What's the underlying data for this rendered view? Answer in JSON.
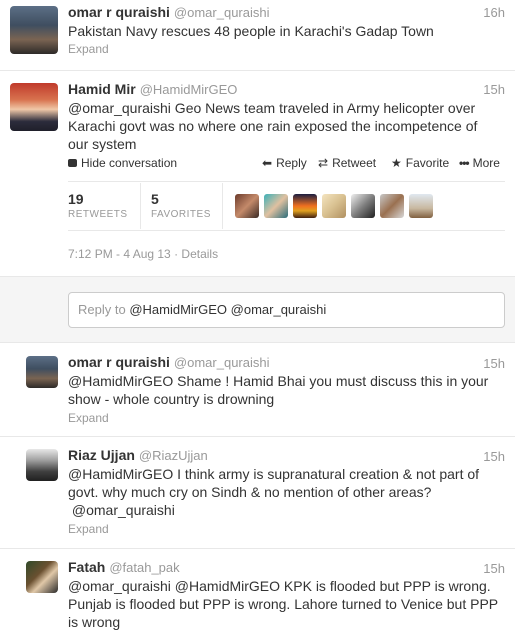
{
  "tweet1": {
    "name": "omar r quraishi",
    "handle": "@omar_quraishi",
    "time": "16h",
    "text": "Pakistan Navy rescues 48 people in Karachi's Gadap Town",
    "expand": "Expand"
  },
  "tweet2": {
    "name": "Hamid Mir",
    "handle": "@HamidMirGEO",
    "time": "15h",
    "line1": "@omar_quraishi Geo News team traveled in Army helicopter over",
    "line2": "Karachi govt was no where one rain exposed the incompetence of",
    "line3": "our system",
    "hide": "Hide conversation",
    "reply": "Reply",
    "retweet": "Retweet",
    "favorite": "Favorite",
    "more": "More",
    "retweets_count": "19",
    "retweets_label": "RETWEETS",
    "favorites_count": "5",
    "favorites_label": "FAVORITES",
    "timestamp": "7:12 PM - 4 Aug 13 · Details"
  },
  "reply_box": {
    "prefix": "Reply to",
    "mentions": "@HamidMirGEO @omar_quraishi"
  },
  "replies": [
    {
      "name": "omar r quraishi",
      "handle": "@omar_quraishi",
      "time": "15h",
      "line1": "@HamidMirGEO Shame ! Hamid Bhai you must discuss this in your",
      "line2": "show - whole country is drowning",
      "expand": "Expand"
    },
    {
      "name": "Riaz Ujjan",
      "handle": "@RiazUjjan",
      "time": "15h",
      "line1": "@HamidMirGEO I think army is supranatural creation & not part of",
      "line2": "govt. why much cry on Sindh & no mention of other areas?",
      "line3": " @omar_quraishi",
      "expand": "Expand"
    },
    {
      "name": "Fatah",
      "handle": "@fatah_pak",
      "time": "15h",
      "line1": "@omar_quraishi @HamidMirGEO KPK is flooded but PPP is wrong.",
      "line2": "Punjab is flooded but PPP is wrong. Lahore turned to Venice but PPP",
      "line3": "is wrong"
    }
  ],
  "colors": {
    "link": "#333333",
    "muted": "#999999",
    "separator": "#e8e8e8",
    "thread_bg": "#f5f5f5"
  }
}
